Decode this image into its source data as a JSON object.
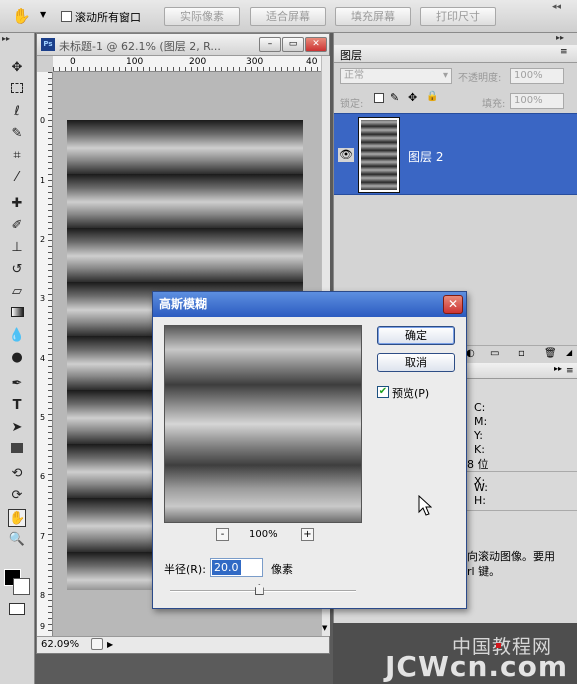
{
  "options_bar": {
    "scroll_all_checkbox_label": "滚动所有窗口",
    "buttons": [
      "实际像素",
      "适合屏幕",
      "填充屏幕",
      "打印尺寸"
    ]
  },
  "document": {
    "title": "未标题-1 @ 62.1% (图层 2, R...",
    "ruler_ticks": [
      "0",
      "100",
      "200",
      "300",
      "40"
    ],
    "vertical_ruler_ticks": [
      "0",
      "1",
      "2",
      "3",
      "4",
      "5",
      "6",
      "7",
      "8",
      "9"
    ],
    "zoom_status": "62.09%"
  },
  "layers_panel": {
    "tab_label": "图层",
    "blend_mode": "正常",
    "opacity_label": "不透明度:",
    "opacity_value": "100%",
    "lock_label": "锁定:",
    "fill_label": "填充:",
    "fill_value": "100%",
    "layer_name": "图层 2"
  },
  "info_panel": {
    "lines": [
      "C:",
      "M:",
      "Y:",
      "K:",
      "8 位",
      "X:",
      "W:",
      "H:"
    ],
    "hint_line1": "向滚动图像。要用",
    "hint_line2": "rl 键。"
  },
  "dialog": {
    "title": "高斯模糊",
    "ok_label": "确定",
    "cancel_label": "取消",
    "preview_label": "预览(P)",
    "preview_checked": true,
    "zoom_minus": "-",
    "zoom_plus": "+",
    "zoom_level": "100%",
    "radius_label": "半径(R):",
    "radius_value": "20.0",
    "radius_unit": "像素",
    "slider_fraction": 0.48
  },
  "watermark": {
    "line1": "中国教程网",
    "line2": "JCWcn.com"
  },
  "colors": {
    "selection_blue": "#3a66c4",
    "dialog_title_blue": "#2b5bc0",
    "close_red": "#c33333"
  }
}
